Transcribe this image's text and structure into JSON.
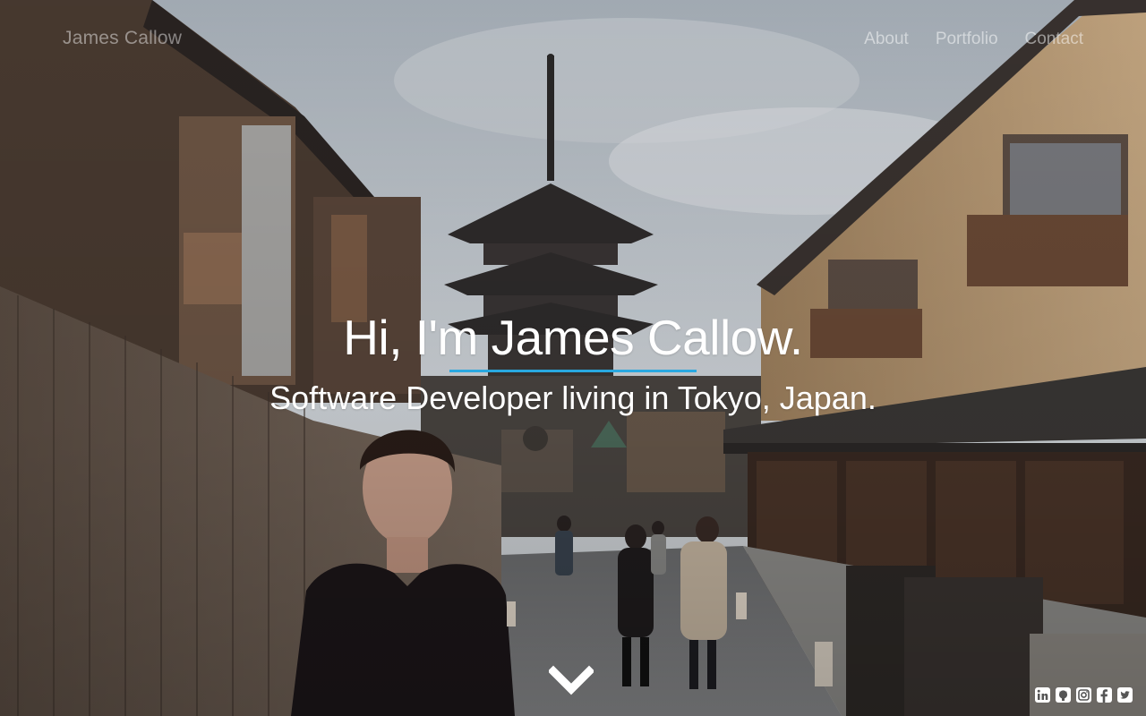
{
  "header": {
    "site_title": "James Callow",
    "nav": [
      {
        "label": "About"
      },
      {
        "label": "Portfolio"
      },
      {
        "label": "Contact"
      }
    ]
  },
  "hero": {
    "headline": "Hi, I'm James Callow.",
    "subheadline": "Software Developer living in Tokyo, Japan.",
    "accent_color": "#29a8e0",
    "scroll_icon": "chevron-down-icon",
    "background": "street-photo-kyoto-pagoda"
  },
  "socials": [
    {
      "icon": "linkedin-icon"
    },
    {
      "icon": "github-icon"
    },
    {
      "icon": "instagram-icon"
    },
    {
      "icon": "facebook-icon"
    },
    {
      "icon": "twitter-icon"
    }
  ]
}
